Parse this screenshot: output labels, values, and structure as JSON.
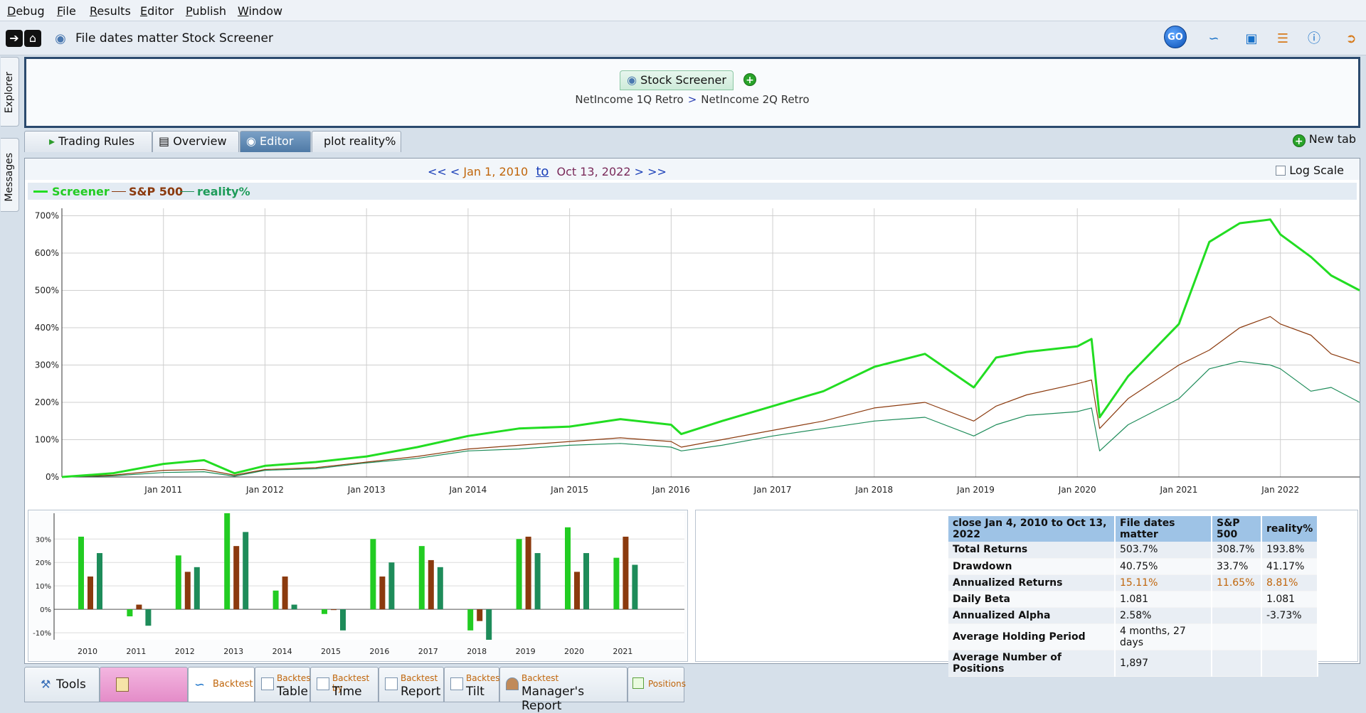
{
  "menu": [
    "Debug",
    "File",
    "Results",
    "Editor",
    "Publish",
    "Window"
  ],
  "toolbar": {
    "title": "File dates matter Stock Screener",
    "go_label": "GO"
  },
  "side_tabs": [
    "Explorer",
    "Messages"
  ],
  "breadcrumb": {
    "tab_label": "Stock Screener",
    "crumbs": [
      "NetIncome 1Q Retro",
      "NetIncome 2Q Retro"
    ],
    "separator": ">"
  },
  "tabs": [
    "Trading Rules",
    "Overview",
    "Editor",
    "plot reality%"
  ],
  "new_tab_label": "New tab",
  "range": {
    "prev": "<< <",
    "start": "Jan 1, 2010",
    "to": "to",
    "end": "Oct 13, 2022",
    "next": "> >>",
    "log_scale_label": "Log Scale"
  },
  "colors": {
    "screener": "#22dd22",
    "sp500": "#8b3a0e",
    "reality": "#1e8c5a",
    "accent": "#0a4fb3"
  },
  "chart_data": [
    {
      "type": "line",
      "ylim": [
        0,
        720
      ],
      "y_tick_labels": [
        "0%",
        "100%",
        "200%",
        "300%",
        "400%",
        "500%",
        "600%",
        "700%"
      ],
      "x_tick_labels": [
        "Jan 2011",
        "Jan 2012",
        "Jan 2013",
        "Jan 2014",
        "Jan 2015",
        "Jan 2016",
        "Jan 2017",
        "Jan 2018",
        "Jan 2019",
        "Jan 2020",
        "Jan 2021",
        "Jan 2022"
      ],
      "x": [
        2010.0,
        2010.5,
        2011.0,
        2011.4,
        2011.7,
        2012.0,
        2012.5,
        2013.0,
        2013.5,
        2014.0,
        2014.5,
        2015.0,
        2015.5,
        2016.0,
        2016.1,
        2016.5,
        2017.0,
        2017.5,
        2018.0,
        2018.5,
        2018.98,
        2019.2,
        2019.5,
        2020.0,
        2020.14,
        2020.22,
        2020.5,
        2021.0,
        2021.3,
        2021.6,
        2021.9,
        2022.0,
        2022.3,
        2022.5,
        2022.78
      ],
      "series": [
        {
          "name": "Screener",
          "values": [
            0,
            10,
            35,
            45,
            10,
            30,
            40,
            55,
            80,
            110,
            130,
            135,
            155,
            140,
            115,
            150,
            190,
            230,
            295,
            330,
            240,
            320,
            335,
            350,
            370,
            160,
            270,
            410,
            630,
            680,
            690,
            650,
            590,
            540,
            500
          ]
        },
        {
          "name": "S&P 500",
          "values": [
            0,
            5,
            18,
            20,
            5,
            20,
            25,
            40,
            55,
            75,
            85,
            95,
            105,
            95,
            80,
            100,
            125,
            150,
            185,
            200,
            150,
            190,
            220,
            250,
            260,
            130,
            210,
            300,
            340,
            400,
            430,
            410,
            380,
            330,
            305
          ]
        },
        {
          "name": "reality%",
          "values": [
            0,
            3,
            12,
            14,
            2,
            18,
            22,
            38,
            50,
            70,
            75,
            85,
            90,
            80,
            70,
            85,
            110,
            130,
            150,
            160,
            110,
            140,
            165,
            175,
            185,
            70,
            140,
            210,
            290,
            310,
            300,
            290,
            230,
            240,
            200
          ]
        }
      ]
    },
    {
      "type": "bar",
      "categories": [
        "2010",
        "2011",
        "2012",
        "2013",
        "2014",
        "2015",
        "2016",
        "2017",
        "2018",
        "2019",
        "2020",
        "2021"
      ],
      "y_tick_labels": [
        "-10%",
        "0%",
        "10%",
        "20%",
        "30%"
      ],
      "ylim": [
        -13,
        41
      ],
      "series": [
        {
          "name": "Screener",
          "values": [
            31,
            -3,
            23,
            41,
            8,
            -2,
            30,
            27,
            -9,
            30,
            35,
            22
          ]
        },
        {
          "name": "S&P 500",
          "values": [
            14,
            2,
            16,
            27,
            14,
            0,
            14,
            21,
            -5,
            31,
            16,
            31
          ]
        },
        {
          "name": "reality%",
          "values": [
            24,
            -7,
            18,
            33,
            2,
            -9,
            20,
            18,
            -13,
            24,
            24,
            19
          ]
        }
      ]
    }
  ],
  "stats": {
    "header": [
      "close Jan 4, 2010 to Oct 13, 2022",
      "File dates matter",
      "S&P 500",
      "reality%"
    ],
    "rows": [
      [
        "Total Returns",
        "503.7%",
        "308.7%",
        "193.8%"
      ],
      [
        "Drawdown",
        "40.75%",
        "33.7%",
        "41.17%"
      ],
      [
        "Annualized Returns",
        "15.11%",
        "11.65%",
        "8.81%"
      ],
      [
        "Daily Beta",
        "1.081",
        "",
        "1.081"
      ],
      [
        "Annualized Alpha",
        "2.58%",
        "",
        "-3.73%"
      ],
      [
        "Average Holding Period",
        "4 months, 27 days",
        "",
        ""
      ],
      [
        "Average Number of Positions",
        "1,897",
        "",
        ""
      ]
    ]
  },
  "bottom_tabs": [
    {
      "small": "",
      "big": "Tools"
    },
    {
      "small": "",
      "big": "Backtest"
    },
    {
      "small": "Backtest",
      "big": "Table"
    },
    {
      "small": "Backtest by",
      "big": "Time"
    },
    {
      "small": "Backtest",
      "big": "Report"
    },
    {
      "small": "Backtest",
      "big": "Tilt"
    },
    {
      "small": "Backtest",
      "big": "Manager's Report"
    },
    {
      "small": "",
      "big": "Positions"
    }
  ]
}
